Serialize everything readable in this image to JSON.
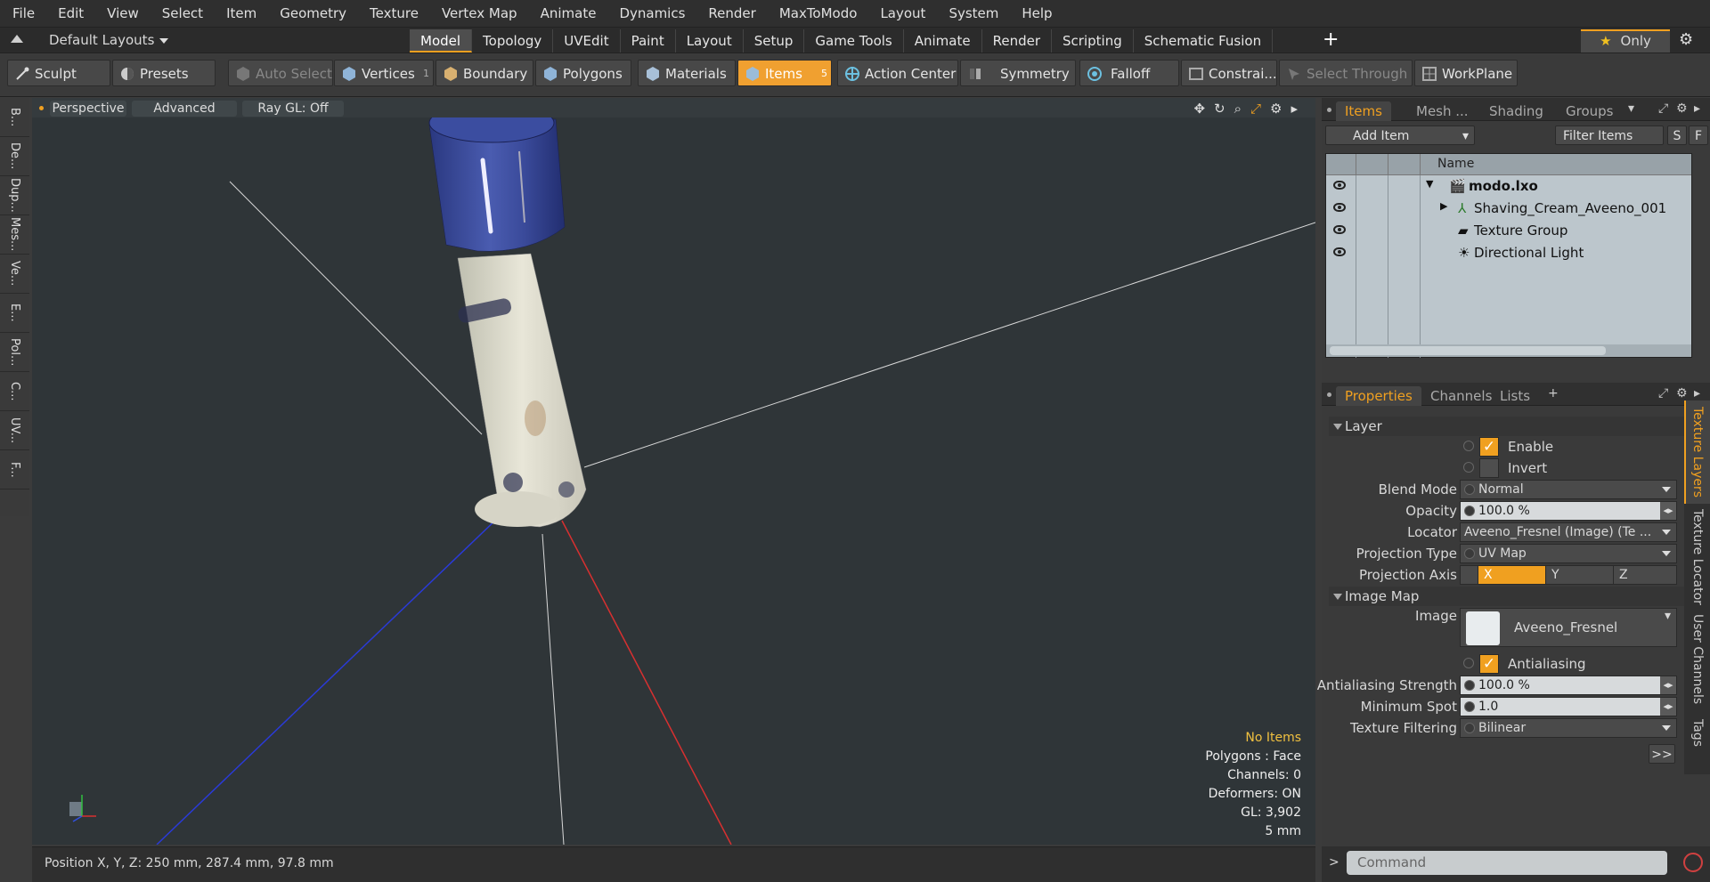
{
  "menu": [
    "File",
    "Edit",
    "View",
    "Select",
    "Item",
    "Geometry",
    "Texture",
    "Vertex Map",
    "Animate",
    "Dynamics",
    "Render",
    "MaxToModo",
    "Layout",
    "System",
    "Help"
  ],
  "layout": {
    "selector": "Default Layouts",
    "tabs": [
      "Model",
      "Topology",
      "UVEdit",
      "Paint",
      "Layout",
      "Setup",
      "Game Tools",
      "Animate",
      "Render",
      "Scripting",
      "Schematic Fusion"
    ],
    "active_tab": "Model",
    "only_label": "Only"
  },
  "toolbar": {
    "sculpt": "Sculpt",
    "presets": "Presets",
    "auto_select": "Auto Select",
    "vertices": "Vertices",
    "vertices_count": "1",
    "boundary": "Boundary",
    "polygons": "Polygons",
    "materials": "Materials",
    "items": "Items",
    "items_count": "5",
    "action_center": "Action Center",
    "symmetry": "Symmetry",
    "falloff": "Falloff",
    "constraints": "Constrai...",
    "select_through": "Select Through",
    "workplane": "WorkPlane"
  },
  "left_tabs": [
    "B...",
    "De...",
    "Dup...",
    "Mes...",
    "Ve...",
    "E...",
    "Pol...",
    "C...",
    "UV...",
    "F..."
  ],
  "viewport": {
    "perspective": "Perspective",
    "advanced": "Advanced",
    "ray_gl": "Ray GL: Off",
    "stats": {
      "no_items": "No Items",
      "polygons": "Polygons : Face",
      "channels": "Channels: 0",
      "deformers": "Deformers: ON",
      "gl": "GL: 3,902",
      "scale": "5 mm"
    }
  },
  "status": {
    "position": "Position X, Y, Z:   250 mm, 287.4 mm, 97.8 mm"
  },
  "items_panel": {
    "tabs": [
      "Items",
      "Mesh ...",
      "Shading",
      "Groups"
    ],
    "add_item": "Add Item",
    "filter_items": "Filter Items",
    "s": "S",
    "f": "F",
    "name_header": "Name",
    "rows": [
      {
        "label": "modo.lxo"
      },
      {
        "label": "Shaving_Cream_Aveeno_001"
      },
      {
        "label": "Texture Group"
      },
      {
        "label": "Directional Light"
      }
    ]
  },
  "properties": {
    "tabs": [
      "Properties",
      "Channels",
      "Lists"
    ],
    "layer_section": "Layer",
    "enable": "Enable",
    "invert": "Invert",
    "blend_mode_label": "Blend Mode",
    "blend_mode": "Normal",
    "opacity_label": "Opacity",
    "opacity": "100.0 %",
    "locator_label": "Locator",
    "locator": "Aveeno_Fresnel (Image) (Te ...",
    "projection_type_label": "Projection Type",
    "projection_type": "UV Map",
    "projection_axis_label": "Projection Axis",
    "axis_x": "X",
    "axis_y": "Y",
    "axis_z": "Z",
    "image_map_section": "Image Map",
    "image_label": "Image",
    "image": "Aveeno_Fresnel",
    "antialiasing": "Antialiasing",
    "aa_strength_label": "Antialiasing Strength",
    "aa_strength": "100.0 %",
    "min_spot_label": "Minimum Spot",
    "min_spot": "1.0",
    "filtering_label": "Texture Filtering",
    "filtering": "Bilinear",
    "more": ">>"
  },
  "side_tabs": [
    "Texture Layers",
    "Texture Locator",
    "User Channels",
    "Tags"
  ],
  "command": {
    "placeholder": "Command"
  }
}
